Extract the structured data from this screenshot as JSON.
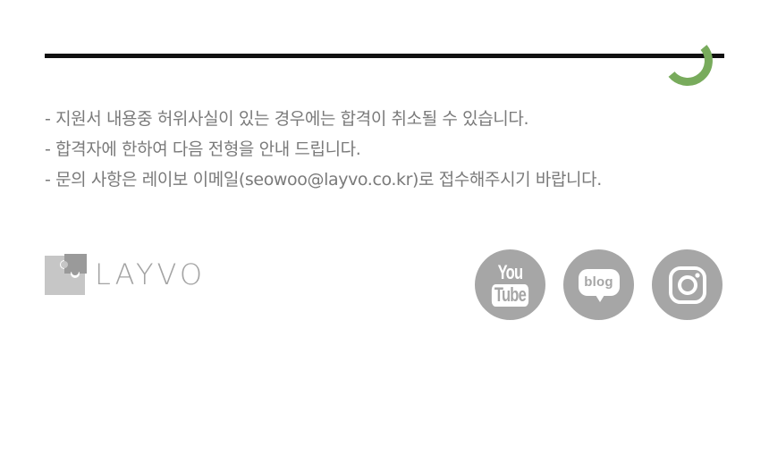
{
  "notices": [
    "- 지원서 내용중 허위사실이 있는 경우에는 합격이 취소될 수 있습니다.",
    "- 합격자에 한하여 다음 전형을 안내 드립니다.",
    "- 문의 사항은 레이보 이메일(seowoo@layvo.co.kr)로 접수해주시기 바랍니다."
  ],
  "brand": {
    "name": "LAYVO",
    "logo_color": "#c3c3c3"
  },
  "socials": {
    "youtube": {
      "line1": "You",
      "line2": "Tube",
      "icon": "youtube-icon"
    },
    "blog": {
      "label": "blog",
      "icon": "blog-icon"
    },
    "instagram": {
      "icon": "instagram-icon"
    }
  },
  "colors": {
    "divider": "#111111",
    "accent_arc": "#78ab5c",
    "text": "#7a7a7a",
    "social_bg": "#a6a6a6"
  }
}
